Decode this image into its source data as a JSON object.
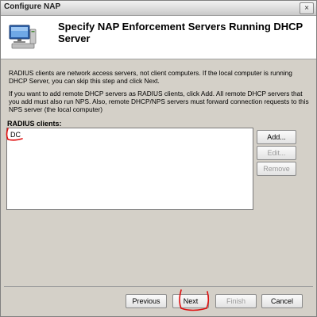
{
  "window": {
    "title": "Configure NAP",
    "close_glyph": "×"
  },
  "header": {
    "icon": "computer-wizard-icon",
    "heading": "Specify NAP Enforcement Servers Running DHCP Server"
  },
  "body": {
    "intro": "RADIUS clients are network access servers, not client computers. If the local computer is running DHCP Server, you can skip this step and click Next.",
    "instructions": "If you want to add remote DHCP servers as RADIUS clients, click Add. All remote DHCP servers that you add must also run NPS. Also, remote DHCP/NPS servers must forward connection requests to this NPS server (the local computer)"
  },
  "radius_clients": {
    "label": "RADIUS clients:",
    "items": [
      "DC"
    ]
  },
  "side_buttons": {
    "add": "Add...",
    "edit": "Edit...",
    "remove": "Remove"
  },
  "footer": {
    "previous": "Previous",
    "next": "Next",
    "finish": "Finish",
    "cancel": "Cancel"
  },
  "annotation_color": "#e01010"
}
